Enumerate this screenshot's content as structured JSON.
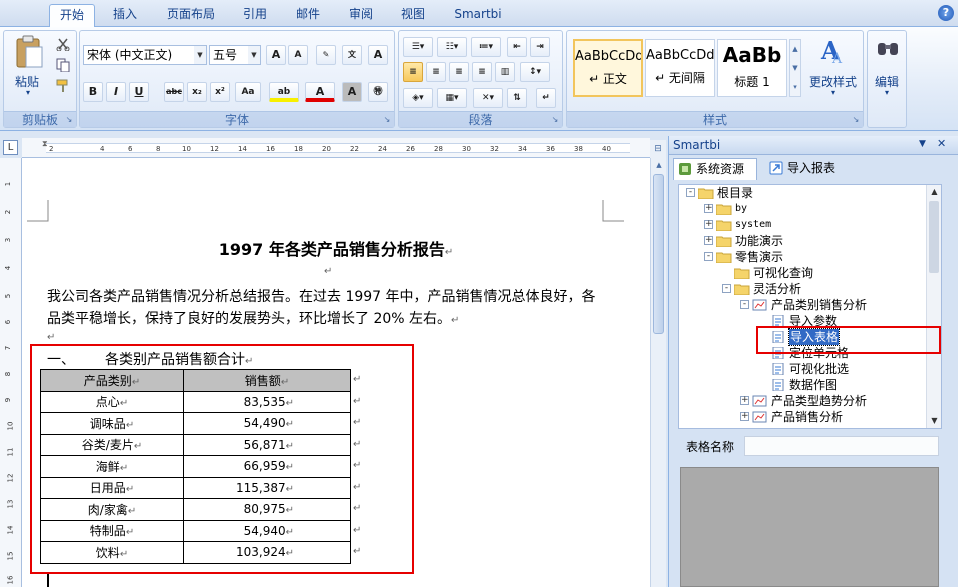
{
  "ribbon_tabs": [
    "开始",
    "插入",
    "页面布局",
    "引用",
    "邮件",
    "审阅",
    "视图",
    "Smartbi"
  ],
  "active_tab": "开始",
  "clipboard": {
    "paste_label": "粘贴",
    "group_label": "剪贴板"
  },
  "font": {
    "name": "宋体 (中文正文)",
    "size": "五号",
    "group_label": "字体"
  },
  "paragraph": {
    "group_label": "段落"
  },
  "styles": {
    "items": [
      {
        "sample": "AaBbCcDd",
        "name": "↵ 正文"
      },
      {
        "sample": "AaBbCcDd",
        "name": "↵ 无间隔"
      },
      {
        "sample": "AaBb",
        "name": "标题 1"
      }
    ],
    "change_label": "更改样式",
    "group_label": "样式"
  },
  "editing": {
    "label": "编辑"
  },
  "ruler": {
    "h_numbers": [
      "2",
      "2",
      "4",
      "6",
      "8",
      "10",
      "12",
      "14",
      "16",
      "18",
      "20",
      "22",
      "24",
      "26",
      "28",
      "30",
      "32",
      "34",
      "36",
      "38",
      "40"
    ],
    "v_numbers": [
      "1",
      "2",
      "3",
      "4",
      "5",
      "6",
      "7",
      "8",
      "9",
      "10",
      "11",
      "12",
      "13",
      "14",
      "15",
      "16"
    ]
  },
  "document": {
    "title": "1997 年各类产品销售分析报告",
    "paragraph": "我公司各类产品销售情况分析总结报告。在过去 1997 年中，产品销售情况总体良好，各品类平稳增长，保持了良好的发展势头，环比增长了 20% 左右。",
    "section_number": "一、",
    "section_title": "各类别产品销售额合计",
    "table": {
      "headers": [
        "产品类别",
        "销售额"
      ],
      "rows": [
        [
          "点心",
          "83,535"
        ],
        [
          "调味品",
          "54,490"
        ],
        [
          "谷类/麦片",
          "56,871"
        ],
        [
          "海鲜",
          "66,959"
        ],
        [
          "日用品",
          "115,387"
        ],
        [
          "肉/家禽",
          "80,975"
        ],
        [
          "特制品",
          "54,940"
        ],
        [
          "饮料",
          "103,924"
        ]
      ]
    }
  },
  "panel": {
    "title": "Smartbi",
    "tabs": [
      "系统资源",
      "导入报表"
    ],
    "tree": [
      {
        "label": "根目录",
        "level": 0,
        "exp": "-"
      },
      {
        "label": "by",
        "level": 1,
        "exp": "+"
      },
      {
        "label": "system",
        "level": 1,
        "exp": "+"
      },
      {
        "label": "功能演示",
        "level": 1,
        "exp": "+"
      },
      {
        "label": "零售演示",
        "level": 1,
        "exp": "-"
      },
      {
        "label": "可视化查询",
        "level": 2,
        "exp": ""
      },
      {
        "label": "灵活分析",
        "level": 2,
        "exp": "-"
      },
      {
        "label": "产品类别销售分析",
        "level": 3,
        "exp": "-"
      },
      {
        "label": "导入参数",
        "level": 4,
        "exp": ""
      },
      {
        "label": "导入表格",
        "level": 4,
        "exp": ""
      },
      {
        "label": "定位单元格",
        "level": 4,
        "exp": ""
      },
      {
        "label": "可视化批选",
        "level": 4,
        "exp": ""
      },
      {
        "label": "数据作图",
        "level": 4,
        "exp": ""
      },
      {
        "label": "产品类型趋势分析",
        "level": 3,
        "exp": "+"
      },
      {
        "label": "产品销售分析",
        "level": 3,
        "exp": "+"
      }
    ],
    "selected_node": "导入表格",
    "name_label": "表格名称",
    "name_value": ""
  },
  "colors": {
    "accent": "#15428b",
    "highlight": "#e60000",
    "selection": "#316ac5"
  }
}
